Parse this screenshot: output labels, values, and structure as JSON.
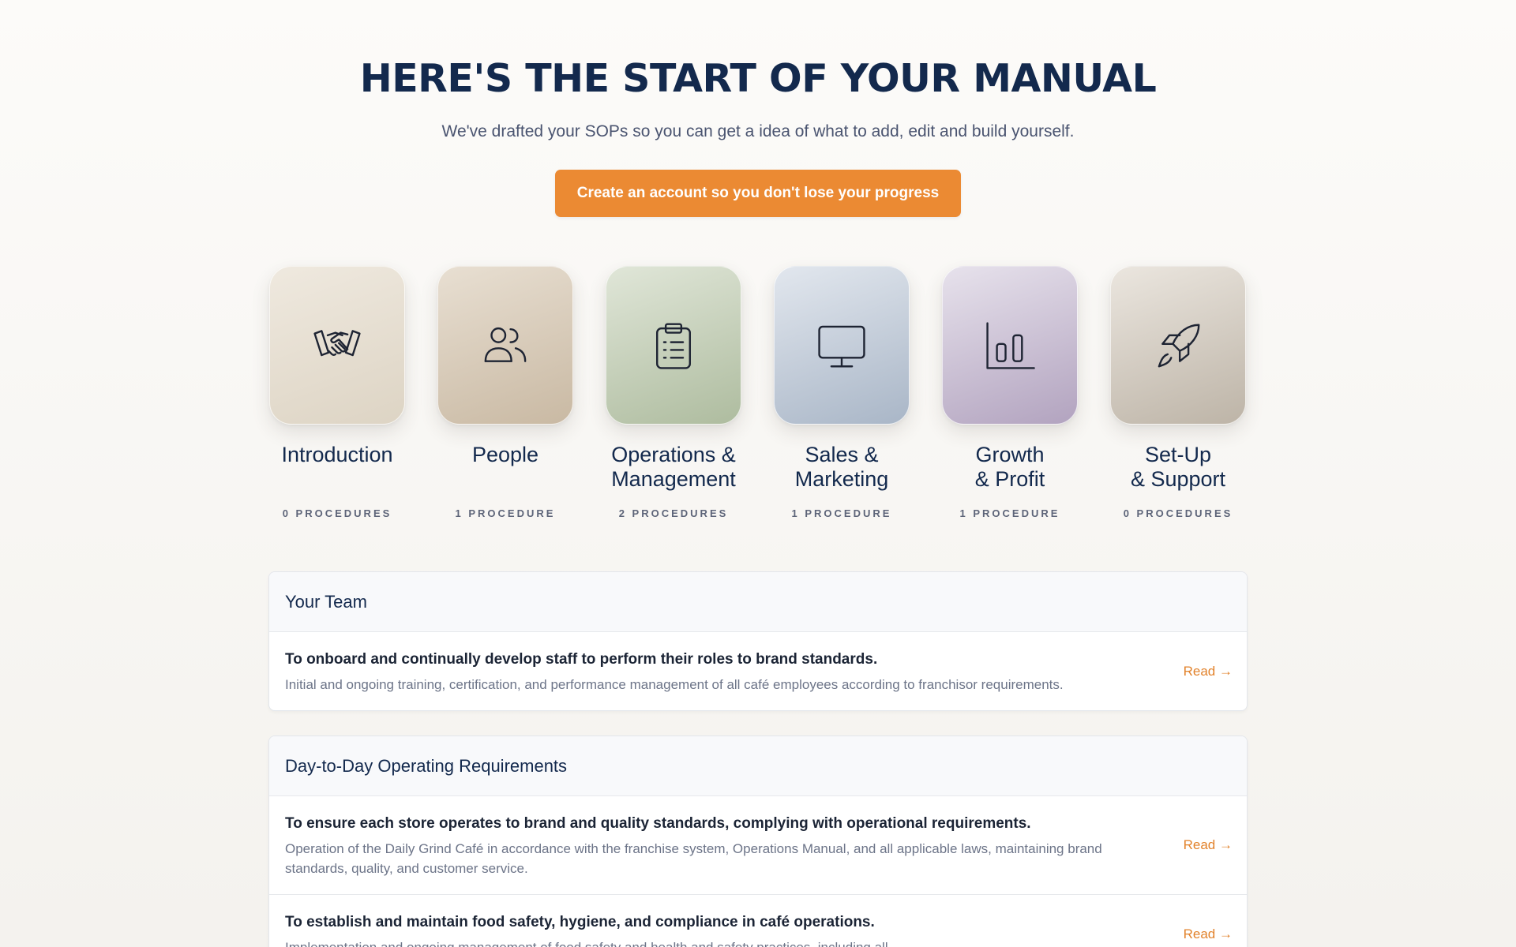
{
  "hero": {
    "title": "HERE'S THE START OF YOUR MANUAL",
    "subtitle": "We've drafted your SOPs so you can get a idea of what to add, edit and build yourself.",
    "cta_label": "Create an account so you don't lose your progress"
  },
  "colors": {
    "accent": "#eb8a33",
    "heading": "#13294d"
  },
  "categories": [
    {
      "label": "Introduction",
      "count": "0 PROCEDURES",
      "icon": "handshake-icon"
    },
    {
      "label": "People",
      "count": "1 PROCEDURE",
      "icon": "users-icon"
    },
    {
      "label": "Operations &\nManagement",
      "count": "2 PROCEDURES",
      "icon": "clipboard-icon"
    },
    {
      "label": "Sales &\nMarketing",
      "count": "1 PROCEDURE",
      "icon": "monitor-icon"
    },
    {
      "label": "Growth\n& Profit",
      "count": "1 PROCEDURE",
      "icon": "bar-chart-icon"
    },
    {
      "label": "Set-Up\n& Support",
      "count": "0 PROCEDURES",
      "icon": "rocket-icon"
    }
  ],
  "sections": [
    {
      "title": "Your Team",
      "items": [
        {
          "title": "To onboard and continually develop staff to perform their roles to brand standards.",
          "description": "Initial and ongoing training, certification, and performance management of all café employees according to franchisor requirements.",
          "link": "Read →"
        }
      ]
    },
    {
      "title": "Day-to-Day Operating Requirements",
      "items": [
        {
          "title": "To ensure each store operates to brand and quality standards, complying with operational requirements.",
          "description": "Operation of the Daily Grind Café in accordance with the franchise system, Operations Manual, and all applicable laws, maintaining brand standards, quality, and customer service.",
          "link": "Read →"
        },
        {
          "title": "To establish and maintain food safety, hygiene, and compliance in café operations.",
          "description": "Implementation and ongoing management of food safety and health and safety practices, including all ...",
          "link": "Read →"
        }
      ]
    }
  ]
}
